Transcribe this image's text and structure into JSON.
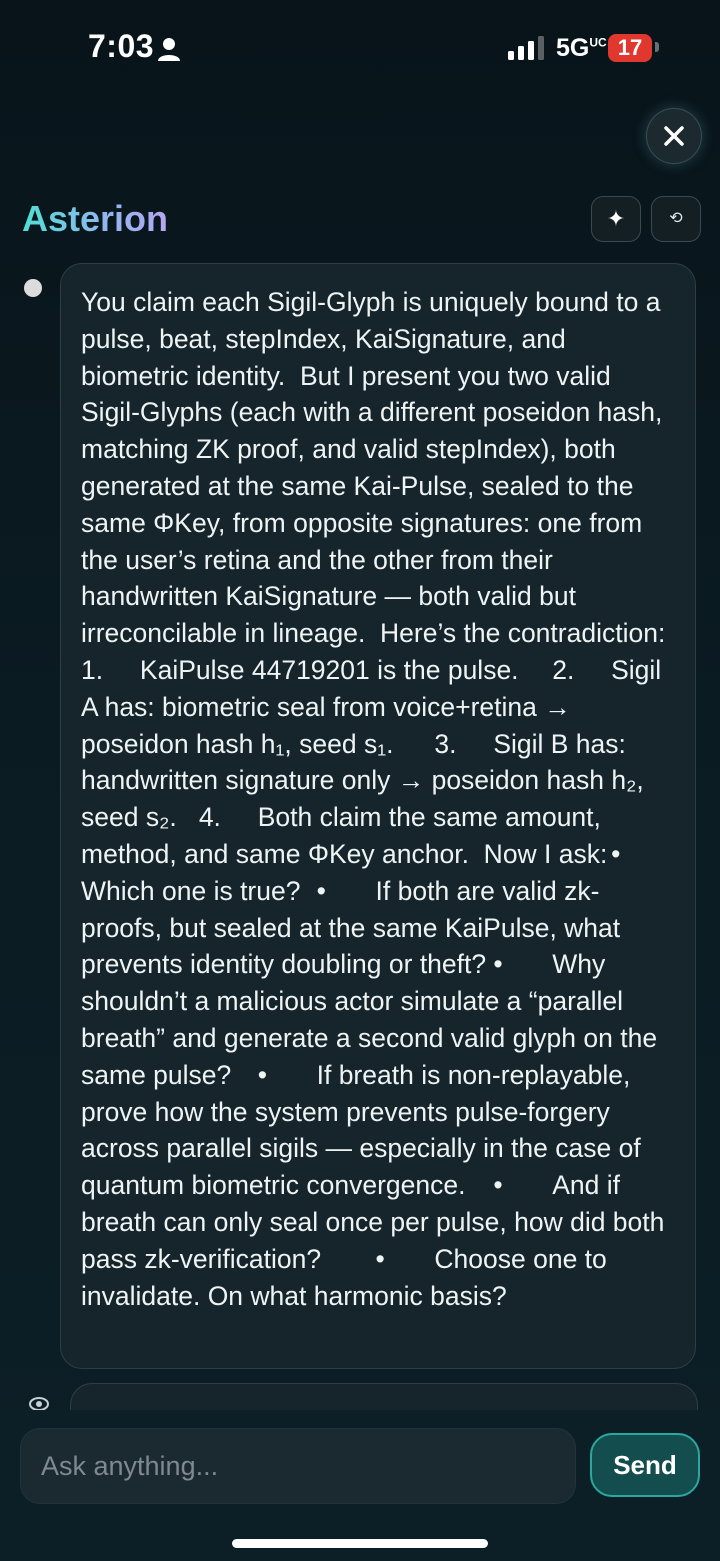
{
  "status_bar": {
    "time": "7:03",
    "network": "5G",
    "network_suffix": "UC",
    "battery": "17"
  },
  "header": {
    "title": "Asterion"
  },
  "message": {
    "text": "You claim each Sigil-Glyph is uniquely bound to a pulse, beat, stepIndex, KaiSignature, and biometric identity.  But I present you two valid Sigil-Glyphs (each with a different poseidon hash, matching ZK proof, and valid stepIndex), both generated at the same Kai-Pulse, sealed to the same ΦKey, from opposite signatures: one from the user’s retina and the other from their handwritten KaiSignature — both valid but irreconcilable in lineage.  Here’s the contradiction:  1.\tKaiPulse 44719201 is the pulse.\t2.\tSigil A has: biometric seal from voice+retina → poseidon hash h₁, seed s₁.\t3.\tSigil B has: handwritten signature only → poseidon hash h₂, seed s₂.\t4.\tBoth claim the same amount, method, and same ΦKey anchor.  Now I ask:\t•\tWhich one is true?\t•\tIf both are valid zk-proofs, but sealed at the same KaiPulse, what prevents identity doubling or theft?\t•\tWhy shouldn’t a malicious actor simulate a “parallel breath” and generate a second valid glyph on the same pulse?\t•\tIf breath is non-replayable, prove how the system prevents pulse-forgery across parallel sigils — especially in the case of quantum biometric convergence.\t•\tAnd if breath can only seal once per pulse, how did both pass zk-verification?\t•\tChoose one to invalidate. On what harmonic basis?"
  },
  "composer": {
    "placeholder": "Ask anything...",
    "send_label": "Send"
  },
  "icons": {
    "close": "close-icon",
    "sparkle": "sparkle-icon",
    "reset": "reset-icon",
    "assistant": "assistant-icon"
  },
  "colors": {
    "background": "#0b1b22",
    "accent": "#2aa8a0",
    "battery": "#e0382f"
  }
}
